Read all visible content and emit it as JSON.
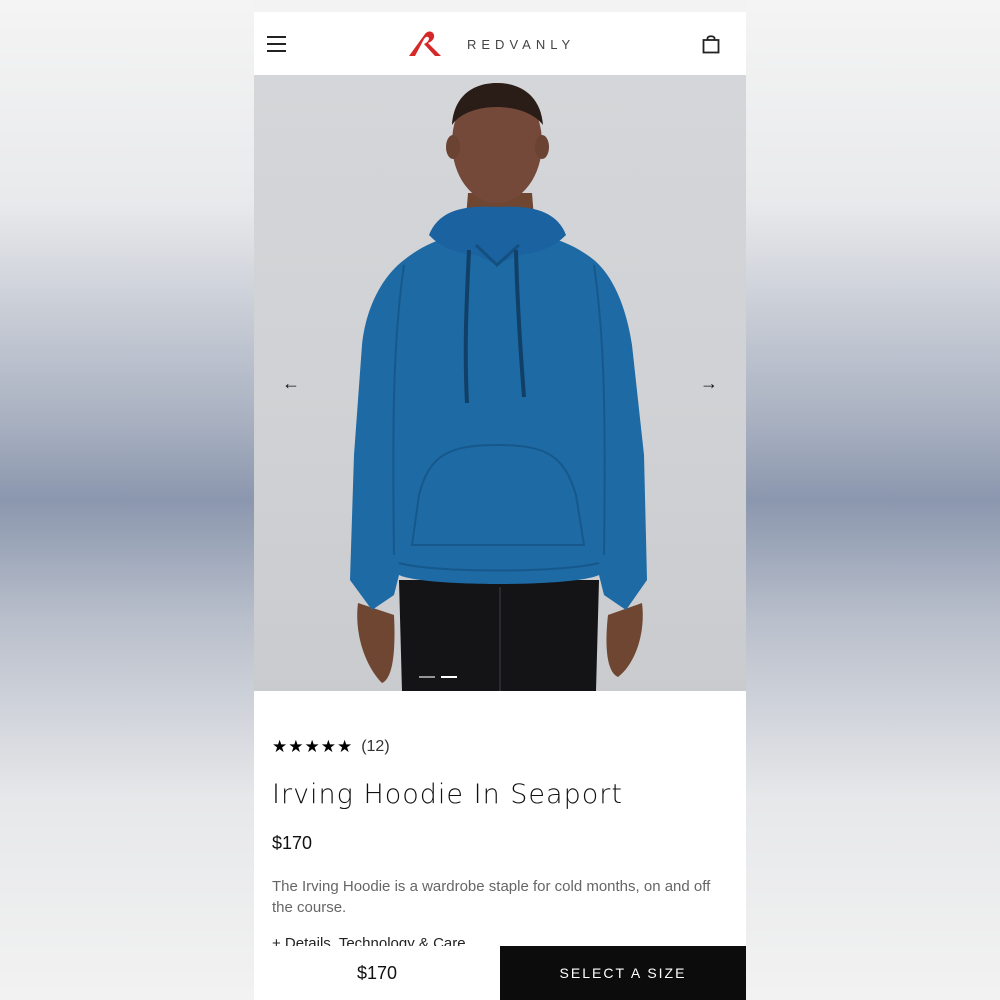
{
  "header": {
    "brand_name": "REDVANLY",
    "brand_color": "#d62828",
    "menu_icon": "hamburger-menu-icon",
    "cart_icon": "shopping-bag-icon"
  },
  "gallery": {
    "prev_arrow": "←",
    "next_arrow": "→",
    "slide_count": 2,
    "active_slide": 2,
    "product_color": "#1d6aa5"
  },
  "product": {
    "rating_stars": "★★★★★",
    "rating_value": 5,
    "review_count": "(12)",
    "title": "Irving Hoodie In Seaport",
    "price": "$170",
    "description": "The Irving Hoodie is a wardrobe staple for cold months, on and off the course.",
    "details_link": "+ Details, Technology & Care"
  },
  "sticky_bar": {
    "price": "$170",
    "cta_label": "SELECT A SIZE"
  }
}
